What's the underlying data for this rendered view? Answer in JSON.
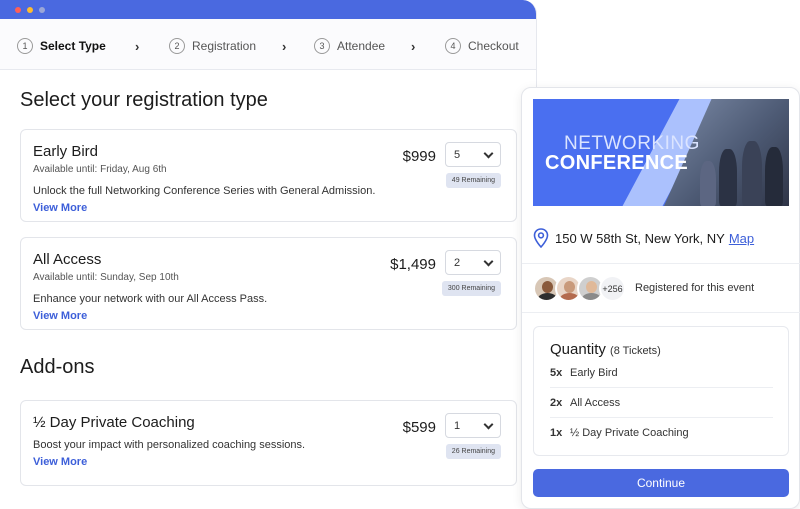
{
  "steps": [
    {
      "num": "1",
      "label": "Select Type"
    },
    {
      "num": "2",
      "label": "Registration"
    },
    {
      "num": "3",
      "label": "Attendee"
    },
    {
      "num": "4",
      "label": "Checkout"
    }
  ],
  "section_title": "Select your registration type",
  "addons_title": "Add-ons",
  "tickets": [
    {
      "title": "Early Bird",
      "avail": "Available until: Friday, Aug 6th",
      "desc": "Unlock the full Networking Conference Series with General Admission.",
      "more": "View More",
      "price": "$999",
      "qty": "5",
      "remaining": "49 Remaining"
    },
    {
      "title": "All Access",
      "avail": "Available until: Sunday, Sep 10th",
      "desc": "Enhance your network with our All Access Pass.",
      "more": "View More",
      "price": "$1,499",
      "qty": "2",
      "remaining": "300 Remaining"
    }
  ],
  "addons": [
    {
      "title": "½ Day Private Coaching",
      "desc": "Boost your impact with personalized coaching sessions.",
      "more": "View More",
      "price": "$599",
      "qty": "1",
      "remaining": "26 Remaining"
    }
  ],
  "event": {
    "banner_line1": "NETWORKING",
    "banner_line2": "CONFERENCE",
    "address": "150 W 58th St, New York, NY",
    "map_link": "Map",
    "attendee_count": "+256",
    "registered_text": "Registered for this event"
  },
  "summary": {
    "title": "Quantity",
    "subtitle": "(8 Tickets)",
    "rows": [
      {
        "qty": "5x",
        "name": "Early Bird"
      },
      {
        "qty": "2x",
        "name": "All Access"
      },
      {
        "qty": "1x",
        "name": "½ Day Private Coaching"
      }
    ],
    "continue_label": "Continue"
  },
  "colors": {
    "accent": "#4a69e0",
    "link": "#3d5fd9"
  }
}
